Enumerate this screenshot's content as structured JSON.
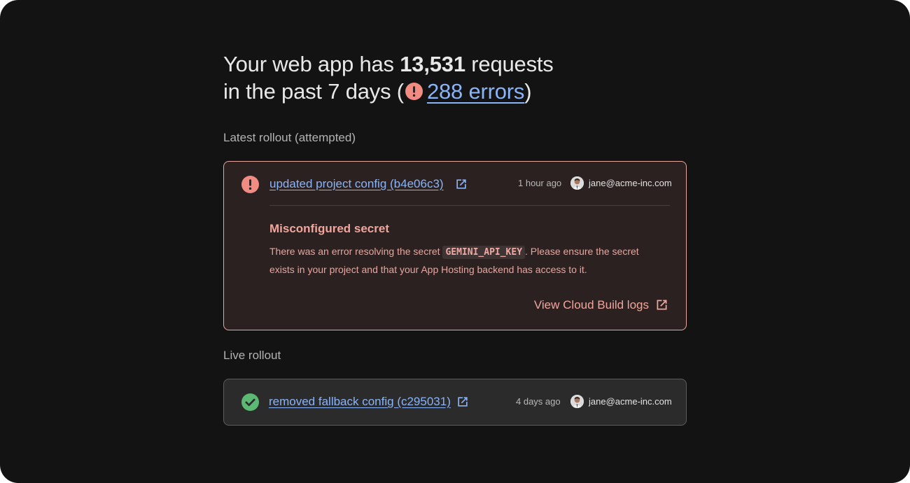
{
  "summary": {
    "prefix": "Your web app has ",
    "request_count": "13,531",
    "suffix": " requests",
    "line2_prefix": "in the past 7 days (",
    "errors_link": "288 errors",
    "line2_suffix": ")"
  },
  "latest_rollout": {
    "section_label": "Latest rollout (attempted)",
    "status": "error",
    "commit_link": "updated project config (b4e06c3)",
    "time_ago": "1 hour ago",
    "user_email": "jane@acme-inc.com",
    "error": {
      "title": "Misconfigured secret",
      "body_before": "There was an error resolving the secret ",
      "secret_name": "GEMINI_API_KEY",
      "body_after": ". Please ensure the secret exists in your project and that your App Hosting backend has access to it."
    },
    "logs_button": "View Cloud Build logs"
  },
  "live_rollout": {
    "section_label": "Live rollout",
    "status": "success",
    "commit_link": "removed fallback config (c295031)",
    "time_ago": "4 days ago",
    "user_email": "jane@acme-inc.com"
  },
  "colors": {
    "background": "#131313",
    "link": "#8ab4f8",
    "error": "#f2a59c",
    "error_icon": "#f28b82",
    "success_icon": "#5bb974"
  },
  "icons": {
    "error": "error-circle-icon",
    "success": "check-circle-icon",
    "external": "open-in-new-icon",
    "avatar": "user-avatar"
  }
}
